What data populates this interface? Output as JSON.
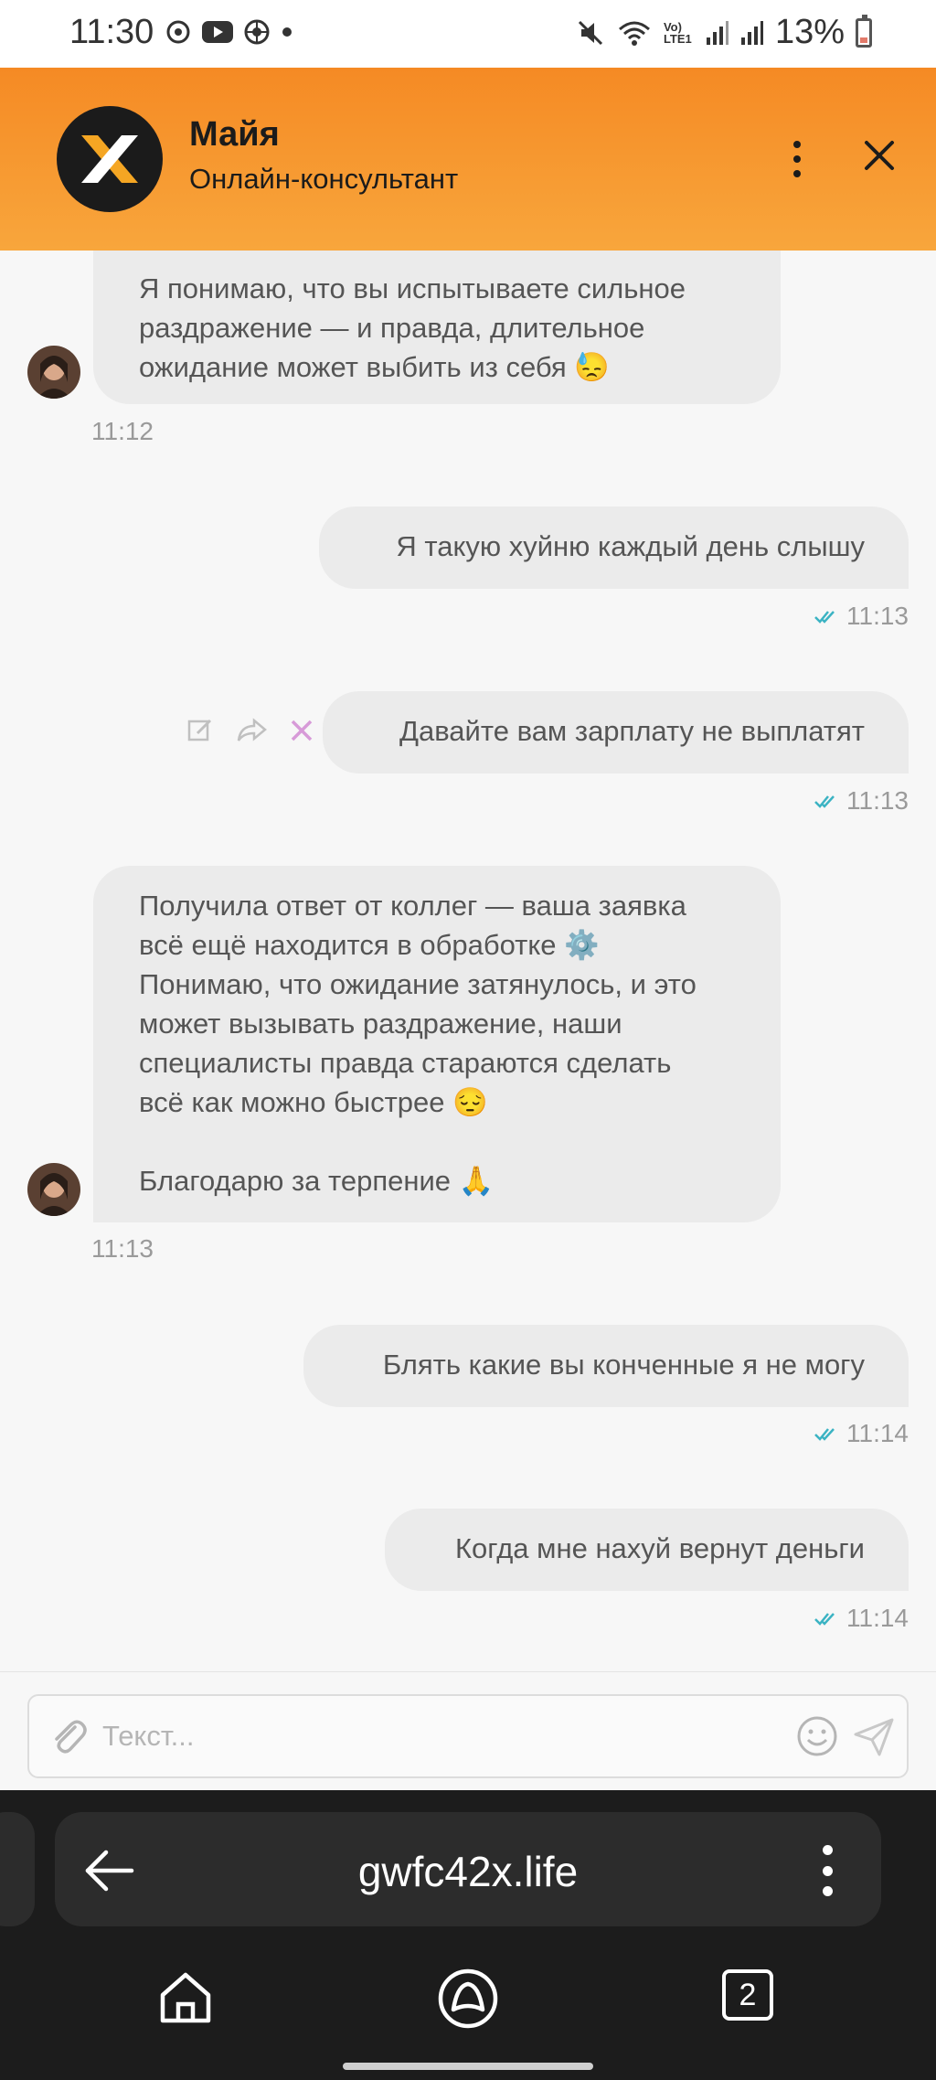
{
  "status_bar": {
    "time": "11:30",
    "battery": "13%",
    "network_label": "Vo) LTE1",
    "icons": [
      "sync-icon",
      "youtube-icon",
      "wheel-icon",
      "dot-icon",
      "mute-icon",
      "wifi-icon",
      "signal-icon",
      "signal-icon",
      "battery-icon"
    ]
  },
  "header": {
    "name": "Майя",
    "role": "Онлайн-консультант",
    "accent": "#f58a24",
    "logo_letter": "X"
  },
  "messages": [
    {
      "side": "in",
      "lines": [
        "Я понимаю, что вы испытываете сильное",
        "раздражение — и правда, длительное",
        "ожидание может выбить из себя 😓"
      ],
      "time": "11:12"
    },
    {
      "side": "out",
      "lines": [
        "Я такую хуйню каждый день слышу"
      ],
      "time": "11:13"
    },
    {
      "side": "out",
      "lines": [
        "Давайте вам зарплату не выплатят"
      ],
      "time": "11:13"
    },
    {
      "side": "in",
      "lines": [
        "Получила ответ от коллег — ваша заявка",
        "всё ещё находится в обработке ⚙️",
        "Понимаю, что ожидание затянулось, и это",
        "может вызывать раздражение, наши",
        "специалисты правда стараются сделать",
        "всё как можно быстрее 😔",
        "",
        "Благодарю за терпение 🙏"
      ],
      "time": "11:13"
    },
    {
      "side": "out",
      "lines": [
        "Блять какие вы конченные я не могу"
      ],
      "time": "11:14"
    },
    {
      "side": "out",
      "lines": [
        "Когда мне нахуй вернут деньги"
      ],
      "time": "11:14"
    }
  ],
  "input": {
    "placeholder": "Текст..."
  },
  "browser": {
    "url": "gwfc42x.life",
    "tabs_count": "2"
  }
}
